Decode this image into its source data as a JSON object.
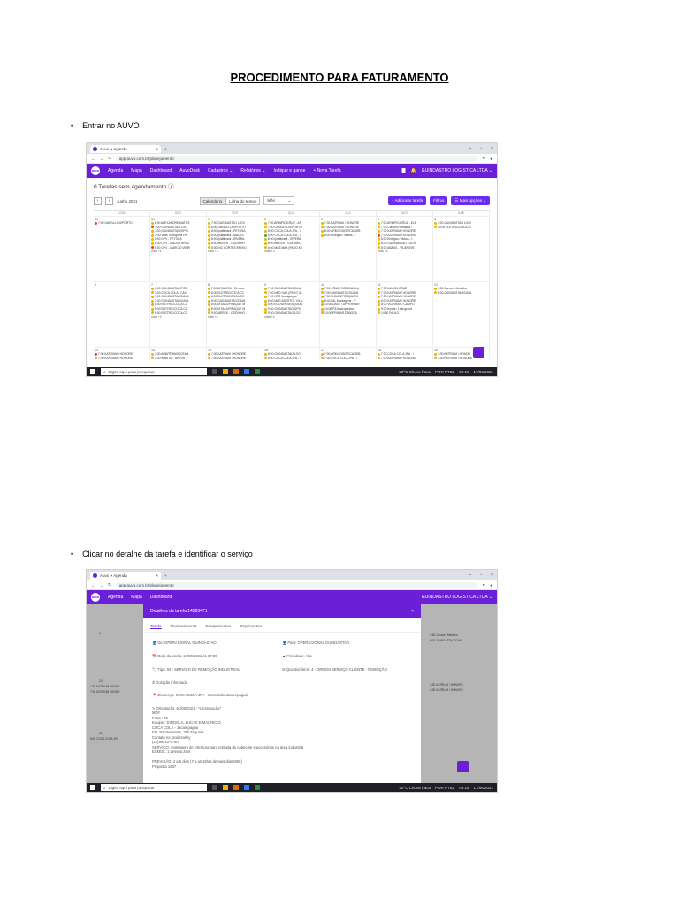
{
  "document": {
    "title": "PROCEDIMENTO PARA FATURAMENTO",
    "step1": "Entrar no AUVO",
    "step2": "Clicar no detalhe da tarefa e identificar o serviço"
  },
  "browser": {
    "tab_title": "Auvo ● Agenda",
    "url1": "app.auvo.com.br/planejamento",
    "url2": "app.auvo.com.br/planejamento"
  },
  "app_nav": {
    "logo": "auvo",
    "items": [
      "Agenda",
      "Mapa",
      "Dashboard",
      "AuvoDesk",
      "Cadastros ⌄",
      "Relatórios ⌄",
      "Indique e ganhe",
      "+ Nova Tarefa"
    ],
    "company": "GUINDASTRO LOGISTICA LTDA ⌄"
  },
  "calendar": {
    "unscheduled": "0  Tarefas sem agendamento  ⓘ",
    "month": "Junho 2021",
    "views": [
      "Calendário",
      "Linha do tempo"
    ],
    "view_select": "Mês",
    "actions": [
      "+ Adicionar tarefa",
      "Filtros",
      "☰ Mais opções ⌄"
    ],
    "weekdays": [
      "DOM",
      "SEG",
      "TER",
      "QUA",
      "QUI",
      "SEX",
      "SÁB"
    ],
    "week1": [
      {
        "day": "30",
        "events": [
          [
            "r",
            "7:00 GAVEA LOG/PORTO"
          ]
        ],
        "more": ""
      },
      {
        "day": "31",
        "events": [
          [
            "",
            "6:00 ALEXANDRE MATOS"
          ],
          [
            "r",
            "7:00 GUINDASTAO LOG"
          ],
          [
            "",
            "7:00 GUINDASTAO/OPCI"
          ],
          [
            "",
            "7:00 Vidal Transporte Pe"
          ],
          [
            "",
            "8:00 GPV - PETOSA"
          ],
          [
            "",
            "8:00 GPV - MACIEL BRAZ"
          ],
          [
            "r",
            "8:00 GPV - MARCIO VIEIR"
          ]
        ],
        "more": "mais +5"
      },
      {
        "day": "1",
        "events": [
          [
            "",
            "7:00 GUINDASTAO LOGÍ"
          ],
          [
            "",
            "8:00 GAVEA LOG/PORTO"
          ],
          [
            "",
            "8:00 Ipiafibrasil - PETOSA"
          ],
          [
            "",
            "8:00 Ipiafibrasil - MACIEL"
          ],
          [
            "",
            "8:00 Ipiafibrasil - RIVERA"
          ],
          [
            "",
            "8:00 MERCK - GODINHO"
          ],
          [
            "",
            "8:30 INC CORTES BRIVIO"
          ]
        ],
        "more": "mais +2"
      },
      {
        "day": "2",
        "events": [
          [
            "",
            "7:00 ARM/FIDICRUZ - AR"
          ],
          [
            "",
            "7:00 GAVEA LOG/PORTO"
          ],
          [
            "",
            "8:00 COCA COLA JPA - I"
          ],
          [
            "gn",
            "8:00 COCA COLA JPA - I"
          ],
          [
            "",
            "8:00 Ipiafibrasil - RIVERA"
          ],
          [
            "",
            "8:00 MERCK - GODINHO"
          ],
          [
            "",
            "8:00 MAS MAX (PATIO MI"
          ]
        ],
        "more": "mais +3"
      },
      {
        "day": "3",
        "events": [
          [
            "",
            "7:30 KATRIUM / HONORÉ"
          ],
          [
            "",
            "7:30 KATRIUM / HONORE"
          ],
          [
            "",
            "8:00 ARM LOGISTICA/SEB"
          ],
          [
            "",
            "8:00 Energac / Marca - I"
          ]
        ],
        "more": ""
      },
      {
        "day": "4",
        "events": [
          [
            "",
            "7:00 ARM/FIDICRUZ - ELE"
          ],
          [
            "",
            "7:30 Consorc Metalica /"
          ],
          [
            "",
            "7:30 KATRIUM / HONORE"
          ],
          [
            "r",
            "7:30 KATRIUM / HONORE"
          ],
          [
            "",
            "8:00 Energac / Marca - I"
          ],
          [
            "",
            "8:00 GUINDASTAO LOGÍS"
          ],
          [
            "",
            "8:00 ABAUS - VILAROVE"
          ]
        ],
        "more": "mais +5"
      },
      {
        "day": "5",
        "events": [
          [
            "",
            "7:00 GUINDASTAO LOGÍ"
          ],
          [
            "",
            "10:00 ELETRIC/COCA CI"
          ]
        ],
        "more": ""
      }
    ],
    "week2": [
      {
        "day": "6",
        "events": [],
        "more": ""
      },
      {
        "day": "7",
        "events": [
          [
            "",
            "6:00 GUINDASTAO/FIRE"
          ],
          [
            "",
            "7:00 COCA COLA / CAXI"
          ],
          [
            "",
            "7:00 GUINDASTAO/CAVA"
          ],
          [
            "",
            "7:00 GUINDASTAO/CAVA"
          ],
          [
            "",
            "8:00 ELETRIC/COCA CC"
          ],
          [
            "",
            "8:00 ELETRIC/COCA CC"
          ],
          [
            "",
            "8:00 ELETRIC/COCA CC"
          ]
        ],
        "more": "mais +4"
      },
      {
        "day": "8",
        "events": [
          [
            "",
            "7:00 ARM/ARM - CL cara"
          ],
          [
            "",
            "8:00 ELETRIC/COCA CC"
          ],
          [
            "",
            "8:00 ELETRIC/COCA CC"
          ],
          [
            "",
            "8:00 GUINDASTAO/CAVA"
          ],
          [
            "",
            "8:00 M DIAS/PIRAQUE M"
          ],
          [
            "",
            "8:00 M DIAS/PIRAQUE M"
          ],
          [
            "",
            "9:00 MERCK - GODINHO"
          ]
        ],
        "more": "mais +6"
      },
      {
        "day": "9",
        "events": [
          [
            "",
            "7:00 GUINDASTAO/CAVA"
          ],
          [
            "",
            "7:00 NEO GAS (PATIO GL"
          ],
          [
            "",
            "7:00 CPR Itaorigaoga /"
          ],
          [
            "",
            "8:00 MAR ABERTO - VILA"
          ],
          [
            "",
            "8:00 ECOSEN/SEB (SION"
          ],
          [
            "",
            "9:00 GUINDASTAO/OPIO"
          ],
          [
            "",
            "9:30 GUINDASTAO LOG"
          ]
        ],
        "more": "mais +4"
      },
      {
        "day": "10",
        "events": [
          [
            "",
            "7:00 CRIAR SION/DAVILA"
          ],
          [
            "",
            "7:00 GUINDASTAO/CAVA"
          ],
          [
            "",
            "7:30 M.DIAS/PIRAQUE M"
          ],
          [
            "",
            "8:00 L&L Montagens - V"
          ],
          [
            "",
            "10:00 DAST TUPPERWAR"
          ],
          [
            "",
            "10:00 P&G acropadico"
          ],
          [
            "",
            "13:00 PRIMAR CABOCA"
          ]
        ],
        "more": ""
      },
      {
        "day": "11",
        "events": [
          [
            "",
            "7:00 MACIEL BRAZ"
          ],
          [
            "",
            "7:30 KATRIUM / HONORE"
          ],
          [
            "",
            "7:30 KATRIUM / HONORE"
          ],
          [
            "",
            "8:00 KATRIUM / HONORE"
          ],
          [
            "",
            "8:00 VIDEIRAS / CAMPO"
          ],
          [
            "",
            "9:00 Isoma / Lata grand"
          ],
          [
            "",
            "14:30 PAULO"
          ]
        ],
        "more": ""
      },
      {
        "day": "12",
        "events": [
          [
            "",
            "7:30 Consorc Metalico"
          ],
          [
            "",
            "8:00 GUINDASTAO/CAVA"
          ]
        ],
        "more": ""
      }
    ],
    "week3": [
      {
        "day": "13",
        "events": [
          [
            "r",
            "7:30 KATRIUM / HONORE"
          ],
          [
            "",
            "7:30 KATRIUM / HONORE"
          ]
        ]
      },
      {
        "day": "14",
        "events": [
          [
            "",
            "7:00 ARM/TRANSOCEAN"
          ],
          [
            "",
            "7:30 ensiv col - ARTUR"
          ]
        ]
      },
      {
        "day": "15",
        "events": [
          [
            "",
            "7:30 KATRIUM / HONORE"
          ],
          [
            "",
            "7:30 KATRIUM / HONORE"
          ]
        ]
      },
      {
        "day": "16",
        "events": [
          [
            "",
            "8:00 GUINDASTAO LOGI"
          ],
          [
            "",
            "8:00 COCA COLA JPA - I"
          ]
        ]
      },
      {
        "day": "17",
        "events": [
          [
            "",
            "7:00 ARM LOGISTICA/SEB"
          ],
          [
            "",
            "7:30 COCA COLA JPA - I"
          ]
        ]
      },
      {
        "day": "18",
        "events": [
          [
            "",
            "7:30 COCA COLA JPA - I"
          ],
          [
            "",
            "7:30 KATRIUM / HONORE"
          ]
        ]
      },
      {
        "day": "19",
        "events": [
          [
            "",
            "7:30 KATRIUM / HONOR"
          ],
          [
            "",
            "7:30 KATRIUM / HONORE"
          ]
        ]
      }
    ]
  },
  "taskbar": {
    "search_placeholder": "Digite aqui para pesquisar",
    "weather": "20°C  Chuva fraca",
    "lang": "POR PTB2",
    "time1": "09:15",
    "date1": "17/06/2021",
    "time2": "09:15",
    "date2": "17/06/2021"
  },
  "modal": {
    "title": "Detalhes da tarefa 14283471",
    "close": "×",
    "tabs": [
      "Tarefa",
      "Monitoramento",
      "Equipamentos",
      "Orçamentos"
    ],
    "user": "👤 De: OPERACIONAL GUINDASTAO",
    "to": "👤 Para: OPERACIONAL GUINDASTAO",
    "date": "📅 Data da tarefa: 17/06/2021 às 07:30",
    "priority": "▲ Prioridade: Alta",
    "type": "🏷 Tipo: 04 - SERVIÇO DE REMOÇÃO INDUSTRIAL",
    "questionnaire": "☰ Questionários: 4 - ORDEM SERVIÇO CLIENTE - REMOÇÃO",
    "duration": "⏱ Duração informada",
    "address": "📍 Endereço: COCA COLA JPA - Coca Cola Jacarepaguá",
    "orientation": "✎ Orientação: 61/06/2021 - *continuação*",
    "lines": [
      "MDF",
      "Frota : 25",
      "Equipe : DINOOLA, LUCAS E MAURICIO",
      "COCA COLA - Jacarepaguá",
      "Est. Bandeirantes, 350 Taquara",
      "Contato no local Harley",
      "(21)99420-0750",
      "SERVIÇO: montagem de estrutura para retirada de cabeçote e acessórios na área industrial",
      "ESMOL: 1 pessoa 2ton",
      "",
      "PREVISÃO: 4 a 5 dias (7 a as 16hrs demais dias M50)",
      "Proposta 1637"
    ],
    "side_labels": [
      "6",
      "13",
      "20"
    ],
    "side_events": [
      "7:30 KATRIUM / HONO",
      "7:30 KATRIUM / HONO",
      "8:00 COCA COLA JPA"
    ],
    "right_events": [
      "7:30 Consorc Metalico",
      "8:00 GUINDASTAO/CAVA",
      "7:30 KATRIUM / HONORE",
      "7:30 KATRIUM / HONORE"
    ]
  }
}
